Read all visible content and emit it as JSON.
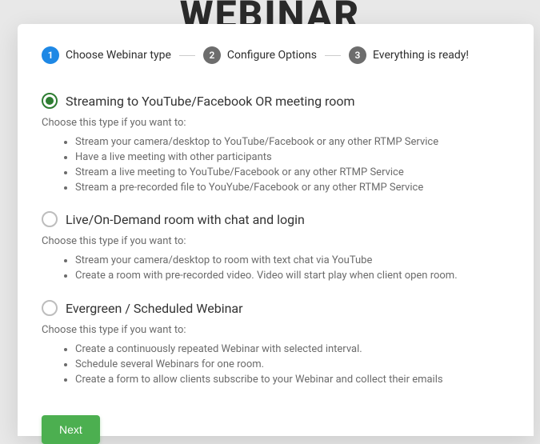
{
  "background_text": "WEBINAR",
  "stepper": [
    {
      "num": "1",
      "label": "Choose Webinar type",
      "active": true
    },
    {
      "num": "2",
      "label": "Configure Options",
      "active": false
    },
    {
      "num": "3",
      "label": "Everything is ready!",
      "active": false
    }
  ],
  "hint_text": "Choose this type if you want to:",
  "options": [
    {
      "id": "streaming",
      "title": "Streaming to YouTube/Facebook OR meeting room",
      "selected": true,
      "bullets": [
        "Stream your camera/desktop to YouTube/Facebook or any other RTMP Service",
        "Have a live meeting with other participants",
        "Stream a live meeting to YouTube/Facebook or any other RTMP Service",
        "Stream a pre-recorded file to YouYube/Facebook or any other RTMP Service"
      ]
    },
    {
      "id": "live-ondemand",
      "title": "Live/On-Demand room with chat and login",
      "selected": false,
      "bullets": [
        "Stream your camera/desktop to room with text chat via YouTube",
        "Create a room with pre-recorded video. Video will start play when client open room."
      ]
    },
    {
      "id": "evergreen",
      "title": "Evergreen / Scheduled Webinar",
      "selected": false,
      "bullets": [
        "Create a continuously repeated Webinar with selected interval.",
        "Schedule several Webinars for one room.",
        "Create a form to allow clients subscribe to your Webinar and collect their emails"
      ]
    }
  ],
  "buttons": {
    "next": "Next"
  },
  "colors": {
    "primary": "#1e88e5",
    "accent": "#4caf50",
    "radio_selected": "#2e7d32"
  }
}
